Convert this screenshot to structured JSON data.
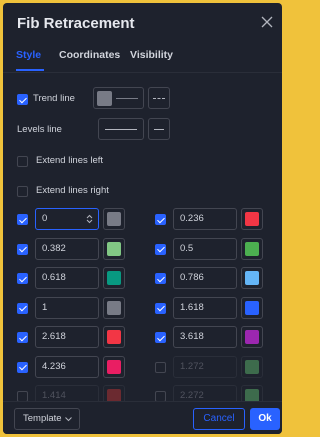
{
  "dialog": {
    "title": "Fib Retracement",
    "tabs": [
      "Style",
      "Coordinates",
      "Visibility"
    ],
    "active_tab": "Style"
  },
  "style": {
    "trend_line": {
      "label": "Trend line",
      "checked": true,
      "line_color": "#787b86"
    },
    "levels_line": {
      "label": "Levels line"
    },
    "extend_left": {
      "label": "Extend lines left",
      "checked": false
    },
    "extend_right": {
      "label": "Extend lines right",
      "checked": false
    }
  },
  "levels": [
    {
      "value": "0",
      "color": "#787b86",
      "checked": true
    },
    {
      "value": "0.236",
      "color": "#f23645",
      "checked": true
    },
    {
      "value": "0.382",
      "color": "#81c784",
      "checked": true
    },
    {
      "value": "0.5",
      "color": "#4caf50",
      "checked": true
    },
    {
      "value": "0.618",
      "color": "#089981",
      "checked": true
    },
    {
      "value": "0.786",
      "color": "#64b5f6",
      "checked": true
    },
    {
      "value": "1",
      "color": "#787b86",
      "checked": true
    },
    {
      "value": "1.618",
      "color": "#2962ff",
      "checked": true
    },
    {
      "value": "2.618",
      "color": "#f23645",
      "checked": true
    },
    {
      "value": "3.618",
      "color": "#9c27b0",
      "checked": true
    },
    {
      "value": "4.236",
      "color": "#e91e63",
      "checked": true
    },
    {
      "value": "1.272",
      "color": "#3d6b4c",
      "checked": false
    },
    {
      "value": "1.414",
      "color": "#6b2a30",
      "checked": false
    },
    {
      "value": "2.272",
      "color": "#3d6b4c",
      "checked": false
    }
  ],
  "footer": {
    "template_label": "Template",
    "cancel_label": "Cancel",
    "ok_label": "Ok"
  }
}
